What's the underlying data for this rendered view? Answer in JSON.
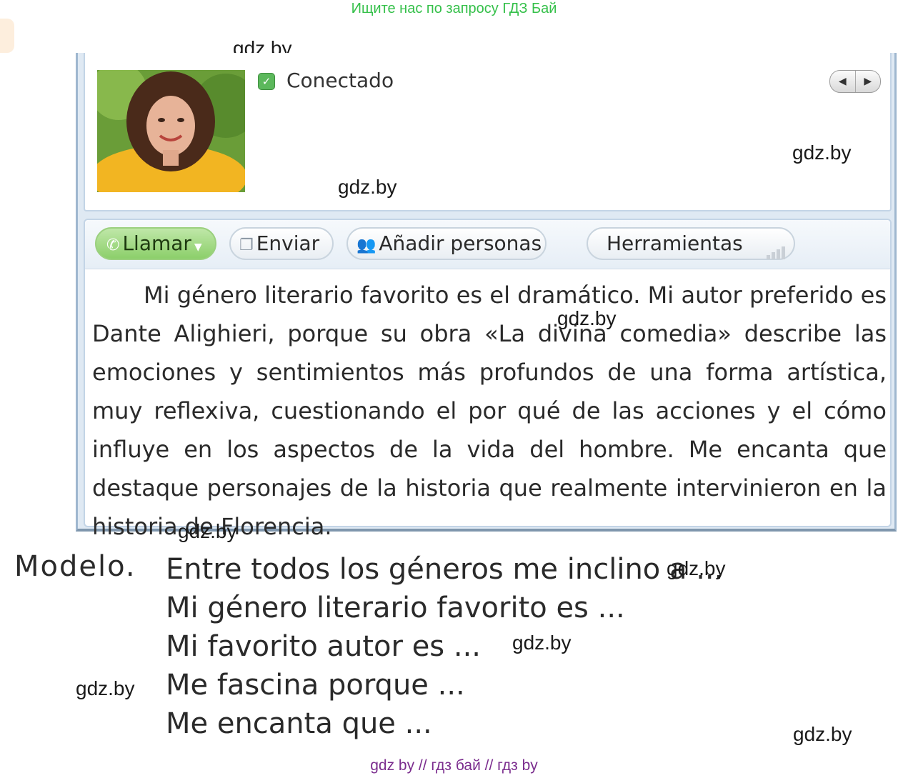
{
  "banner": "Ищите нас по запросу ГДЗ Бай",
  "watermark": "gdz.by",
  "profile": {
    "status": "Conectado",
    "status_icon": "check-shield-icon",
    "nav_prev": "◀",
    "nav_next": "▶"
  },
  "toolbar": {
    "call_label": "Llamar",
    "send_label": "Enviar",
    "add_people_label": "Añadir personas",
    "tools_label": "Herramientas"
  },
  "message": "Mi género literario favorito es el dramático. Mi autor preferido es Dante Alighieri, porque su obra «La divina comedia» describe las emociones y sentimientos más profundos de una forma artística, muy reflexiva, cuestionando el por qué de las acciones y el cómo influye en los aspectos de la vida del hombre. Me encanta que destaque personajes de la historia que realmente intervinieron en la historia de Florencia.",
  "model": {
    "label": "Modelo.",
    "lines": [
      "Entre todos los géneros me inclino a ...",
      "Mi género literario favorito es ...",
      "Mi favorito autor es ...",
      "Me fascina porque ...",
      "Me encanta que ..."
    ]
  },
  "footer": "gdz by  //  гдз бай  //  гдз by",
  "colors": {
    "banner": "#35c04a",
    "call_button": "#8ccf6a",
    "footer": "#7b2d8e",
    "window_frame": "#9fb7cf"
  }
}
